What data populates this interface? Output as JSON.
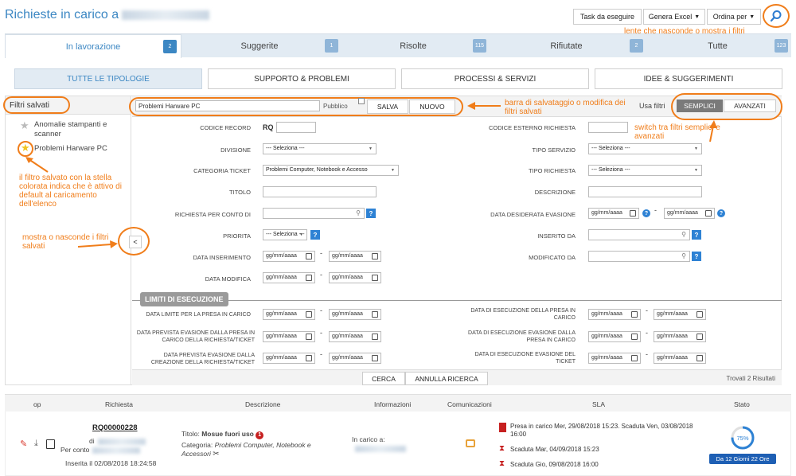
{
  "header": {
    "title": "Richieste in carico a",
    "buttons": {
      "task": "Task da eseguire",
      "excel": "Genera Excel",
      "order": "Ordina per"
    }
  },
  "tabs": [
    {
      "label": "In lavorazione",
      "count": "2"
    },
    {
      "label": "Suggerite",
      "count": "1"
    },
    {
      "label": "Risolte",
      "count": "115"
    },
    {
      "label": "Rifiutate",
      "count": "2"
    },
    {
      "label": "Tutte",
      "count": "123"
    }
  ],
  "categories": [
    "TUTTE LE TIPOLOGIE",
    "SUPPORTO & PROBLEMI",
    "PROCESSI & SERVIZI",
    "IDEE & SUGGERIMENTI"
  ],
  "sidebar": {
    "title": "Filtri salvati",
    "items": [
      {
        "label": "Anomalie stampanti e scanner",
        "starred": false
      },
      {
        "label": "Problemi Harware PC",
        "starred": true
      }
    ],
    "toggle": "<"
  },
  "toolbar": {
    "filter_name": "Problemi Harware PC",
    "public_label": "Pubblico",
    "save_label": "SALVA",
    "new_label": "NUOVO",
    "use_filter_label": "Usa filtri",
    "simple_label": "SEMPLICI",
    "advanced_label": "AVANZATI"
  },
  "form": {
    "codice_record": "CODICE RECORD",
    "rq_prefix": "RQ",
    "codice_esterno": "CODICE ESTERNO RICHIESTA",
    "divisione": "DIVISIONE",
    "divisione_value": "--- Seleziona ---",
    "tipo_servizio": "TIPO SERVIZIO",
    "tipo_servizio_value": "--- Seleziona ---",
    "categoria": "CATEGORIA TICKET",
    "categoria_value": "Problemi Computer, Notebook e Accesso",
    "tipo_richiesta": "TIPO RICHIESTA",
    "tipo_richiesta_value": "--- Seleziona ---",
    "titolo": "TITOLO",
    "descrizione": "DESCRIZIONE",
    "per_conto": "RICHIESTA PER CONTO DI",
    "data_desiderata": "DATA DESIDERATA EVASIONE",
    "priorita": "PRIORITA",
    "priorita_value": "--- Seleziona ---",
    "inserito_da": "INSERITO DA",
    "data_inserimento": "DATA INSERIMENTO",
    "modificato_da": "MODIFICATO DA",
    "data_modifica": "DATA MODIFICA",
    "date_placeholder": "gg/mm/aaaa",
    "dash": "-",
    "q": "?"
  },
  "limits": {
    "title": "LIMITI DI ESECUZIONE",
    "l1": "DATA LIMITE PER LA PRESA IN CARICO",
    "l2": "DATA PREVISTA EVASIONE DALLA PRESA IN CARICO DELLA RICHIESTA/TICKET",
    "l3": "DATA PREVISTA EVASIONE DALLA CREAZIONE DELLA RICHIESTA/TICKET",
    "r1": "DATA DI ESECUZIONE DELLA PRESA IN CARICO",
    "r2": "DATA DI ESECUZIONE EVASIONE DALLA PRESA IN CARICO",
    "r3": "DATA DI ESECUZIONE EVASIONE DEL TICKET"
  },
  "actions": {
    "search": "CERCA",
    "cancel": "ANNULLA RICERCA",
    "found": "Trovati 2 Risultati"
  },
  "results": {
    "headers": [
      "op",
      "Richiesta",
      "Descrizione",
      "Informazioni",
      "Comunicazioni",
      "SLA",
      "Stato"
    ],
    "row": {
      "code": "RQ00000228",
      "by_prefix": "di",
      "for_prefix": "Per conto",
      "inserted": "Inserita il 02/08/2018 18:24:58",
      "title_label": "Titolo:",
      "title_value": "Mosue fuori uso",
      "title_badge": "1",
      "category_label": "Categoria:",
      "category_value": "Problemi Computer, Notebook e Accessori",
      "info_label": "In carico a:",
      "sla1": "Presa in carico Mer, 29/08/2018 15:23. Scaduta Ven, 03/08/2018 16:00",
      "sla2": "Scaduta Mar, 04/09/2018 15:23",
      "sla3": "Scaduta Gio, 09/08/2018 16:00",
      "progress_label": "75%",
      "progress": 0.75,
      "status_badge": "Da 12 Giorni 22 Ore"
    }
  },
  "annotations": {
    "search": "lente che nasconde o mostra i filtri",
    "toolbar": "barra di salvataggio o modifica dei filtri salvati",
    "switch": "switch tra filtri semplici e avanzati",
    "star": "il filtro salvato con la stella colorata indica che è attivo di default al caricamento dell'elenco",
    "toggle": "mostra o nasconde i filtri salvati"
  },
  "colors": {
    "accent": "#3c87c3",
    "annotation": "#f07d1a",
    "help": "#2e82d4",
    "status": "#1e5fb4"
  }
}
